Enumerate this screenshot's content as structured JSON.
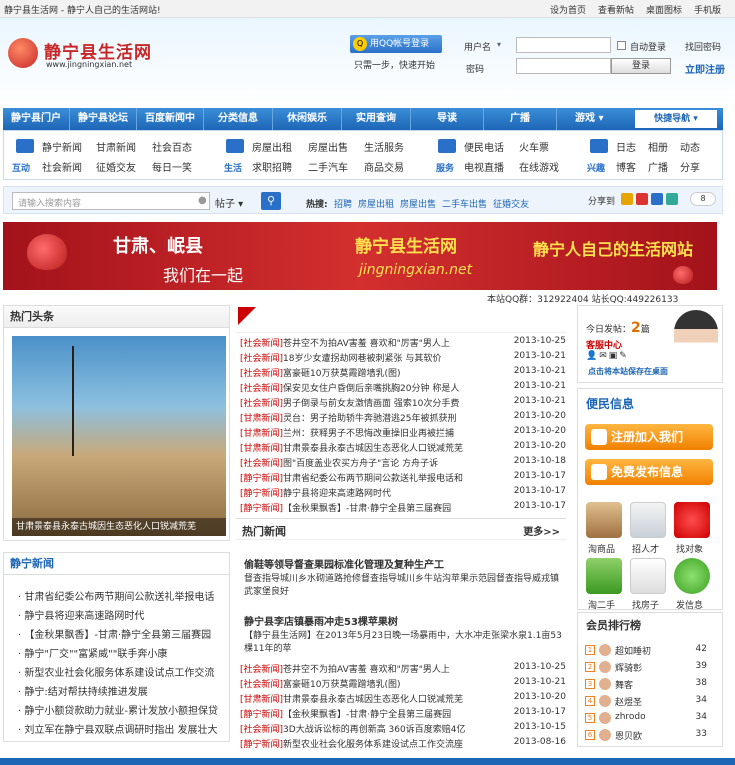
{
  "topbar": {
    "title": "静宁县生活网 - 静宁人自己的生活网站!",
    "links": [
      "设为首页",
      "查看新帖",
      "桌面图标",
      "手机版"
    ]
  },
  "logo": {
    "name": "静宁县生活网",
    "url": "www.jingningxian.net"
  },
  "login": {
    "qq_button": "用QQ帐号登录",
    "qq_hint": "只需一步，快速开始",
    "username_label": "用户名",
    "password_label": "密码",
    "autologin": "自动登录",
    "find_password": "找回密码",
    "submit": "登录",
    "register": "立即注册"
  },
  "nav": {
    "items": [
      "静宁县门户",
      "静宁县论坛",
      "百度新闻中",
      "分类信息",
      "休闲娱乐",
      "实用查询",
      "导读",
      "广播",
      "游戏"
    ],
    "quick": "快捷导航"
  },
  "subnav": {
    "groups": [
      {
        "cap": "互动",
        "items": [
          [
            "静宁新闻",
            "甘肃新闻",
            "社会百态"
          ],
          [
            "社会新闻",
            "征婚交友",
            "每日一笑"
          ]
        ]
      },
      {
        "cap": "生活",
        "items": [
          [
            "房屋出租",
            "房屋出售",
            "生活服务"
          ],
          [
            "求职招聘",
            "二手汽车",
            "商品交易"
          ]
        ]
      },
      {
        "cap": "服务",
        "items": [
          [
            "便民电话",
            "火车票"
          ],
          [
            "电视直播",
            "在线游戏"
          ]
        ]
      },
      {
        "cap": "兴趣",
        "items": [
          [
            "日志",
            "相册",
            "动态"
          ],
          [
            "博客",
            "广播",
            "分享"
          ]
        ]
      }
    ]
  },
  "search": {
    "placeholder": "请输入搜索内容",
    "scope": "帖子",
    "hot_label": "热搜:",
    "hot": [
      "招聘",
      "房屋出租",
      "房屋出售",
      "二手车出售",
      "征婚交友"
    ],
    "share_label": "分享到",
    "share_count": "8"
  },
  "banner": {
    "l1": "甘肃、岷县",
    "l2": "我们在一起",
    "name": "静宁县生活网",
    "url": "jingningxian.net",
    "slogan": "静宁人自己的生活网站"
  },
  "qqline": "本站QQ群：312922404   站长QQ:449226133",
  "headline": {
    "title": "热门头条",
    "caption": "甘肃景泰县永泰古城因生态恶化人口锐减荒芜"
  },
  "news": [
    {
      "tag": "[社会新闻]",
      "t": "苍井空不为拍AV害羞 喜欢和\"厉害\"男人上",
      "d": "2013-10-25"
    },
    {
      "tag": "[社会新闻]",
      "t": "18岁少女遭拐劫网巷被刺紧张 与其软价",
      "d": "2013-10-21"
    },
    {
      "tag": "[社会新闻]",
      "t": "富豪砸10万获莫霞蹭墙乳(图)",
      "d": "2013-10-21"
    },
    {
      "tag": "[社会新闻]",
      "t": "保安见女住户昏倒后亲嘴挑胸20分钟 称是人",
      "d": "2013-10-21"
    },
    {
      "tag": "[社会新闻]",
      "t": "男子倒录与前女友激情画面 强索10次分手费",
      "d": "2013-10-21"
    },
    {
      "tag": "[甘肃新闻]",
      "t": "灵台：男子拾助轿牛奔驰潜逃25年被抓获刑",
      "d": "2013-10-20"
    },
    {
      "tag": "[甘肃新闻]",
      "t": "兰州：获释男子不思悔改重操旧业再被拦捕",
      "d": "2013-10-20"
    },
    {
      "tag": "[甘肃新闻]",
      "t": "甘肃景泰县永泰古城因生态恶化人口锐减荒芜",
      "d": "2013-10-20"
    },
    {
      "tag": "[社会新闻]",
      "t": "图\"百度盖业农买方舟子\"言论 方舟子诉",
      "d": "2013-10-18"
    },
    {
      "tag": "[静宁新闻]",
      "t": "甘肃省纪委公布两节期间公款送礼举报电话和",
      "d": "2013-10-17"
    },
    {
      "tag": "[静宁新闻]",
      "t": "静宁县将迎来高速路网时代",
      "d": "2013-10-17"
    },
    {
      "tag": "[静宁新闻]",
      "t": "【金秋果飘香】-甘肃·静宁全县第三届赛园",
      "d": "2013-10-17"
    }
  ],
  "hot": {
    "title": "热门新闻",
    "more": "更多>>",
    "a_title": "偷鞋等领导督查果园标准化管理及复种生产工",
    "a_desc": "督查指导城川乡水砌道路抢修督查指导城川乡牛站沟苹果示范园督查指导威戎镇武家堡良好",
    "b_title": "静宁县李店镇暴雨冲走53棵苹果树",
    "b_desc": "【静宁县生活网】在2013年5月23日晚一场暴雨中，大水冲走张梁水泉1.1亩53棵11年的苹"
  },
  "news2": [
    {
      "tag": "[社会新闻]",
      "t": "苍井空不为拍AV害羞 喜欢和\"厉害\"男人上",
      "d": "2013-10-25"
    },
    {
      "tag": "[社会新闻]",
      "t": "富豪砸10万获莫霞蹭墙乳(图)",
      "d": "2013-10-21"
    },
    {
      "tag": "[甘肃新闻]",
      "t": "甘肃景泰县永泰古城因生态恶化人口锐减荒芜",
      "d": "2013-10-20"
    },
    {
      "tag": "[静宁新闻]",
      "t": "【金秋果飘香】-甘肃·静宁全县第三届赛园",
      "d": "2013-10-17"
    },
    {
      "tag": "[社会新闻]",
      "t": "3D大战诉讼标的再创新高 360诉百度索赔4亿",
      "d": "2013-10-15"
    },
    {
      "tag": "[静宁新闻]",
      "t": "新型农业社会化服务体系建设试点工作交流座",
      "d": "2013-08-16"
    }
  ],
  "jnnews": {
    "title": "静宁新闻",
    "items": [
      "甘肃省纪委公布两节期间公款送礼举报电话",
      "静宁县将迎来高速路网时代",
      "【金秋果飘香】-甘肃·静宁全县第三届赛园",
      "静宁\"厂交\"\"富紧威\"\"联手奔小康",
      "新型农业社会化服务体系建设试点工作交流",
      "静宁:结对帮扶持续推进发展",
      "静宁小额贷款助力就业-累计发放小额担保贷",
      "刘立军在静宁县双联点调研时指出 发展壮大"
    ]
  },
  "service": {
    "today_label": "今日发帖：",
    "today": "2",
    "unit": "篇",
    "center": "客服中心",
    "save": "点击将本站保存在桌面",
    "title": "便民信息",
    "join": "注册加入我们",
    "post": "免费发布信息",
    "tiles": [
      "淘商品",
      "招人才",
      "找对象",
      "淘二手",
      "找房子",
      "发信息"
    ]
  },
  "ranking": {
    "title": "会员排行榜",
    "items": [
      {
        "n": "1",
        "name": "超如睡初",
        "c": "42"
      },
      {
        "n": "2",
        "name": "辉骑彰",
        "c": "39"
      },
      {
        "n": "3",
        "name": "舞客",
        "c": "38"
      },
      {
        "n": "4",
        "name": "赵煜圣",
        "c": "34"
      },
      {
        "n": "5",
        "name": "zhrodo",
        "c": "34"
      },
      {
        "n": "6",
        "name": "恩贝欧",
        "c": "33"
      }
    ]
  },
  "colors": {
    "accent": "#1d66b6",
    "red": "#cc0000"
  }
}
